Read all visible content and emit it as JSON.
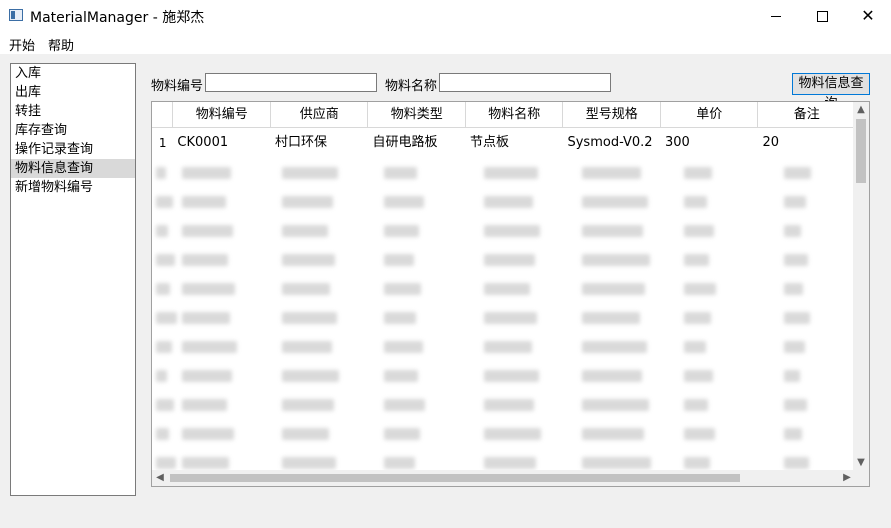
{
  "window": {
    "title": "MaterialManager - 施郑杰"
  },
  "menu": {
    "items": [
      "开始",
      "帮助"
    ]
  },
  "nav": {
    "items": [
      {
        "label": "入库"
      },
      {
        "label": "出库"
      },
      {
        "label": "转挂"
      },
      {
        "label": "库存查询"
      },
      {
        "label": "操作记录查询"
      },
      {
        "label": "物料信息查询",
        "active": true
      },
      {
        "label": "新增物料编号"
      }
    ]
  },
  "search": {
    "code_label": "物料编号",
    "code_value": "",
    "name_label": "物料名称",
    "name_value": "",
    "query_button": "物料信息查询"
  },
  "table": {
    "headers": [
      "物料编号",
      "供应商",
      "物料类型",
      "物料名称",
      "型号规格",
      "单价",
      "备注"
    ],
    "rows": [
      {
        "num": "1",
        "cells": [
          "CK0001",
          "村口环保",
          "自研电路板",
          "节点板",
          "Sysmod-V0.2",
          "300",
          "20"
        ]
      }
    ]
  }
}
